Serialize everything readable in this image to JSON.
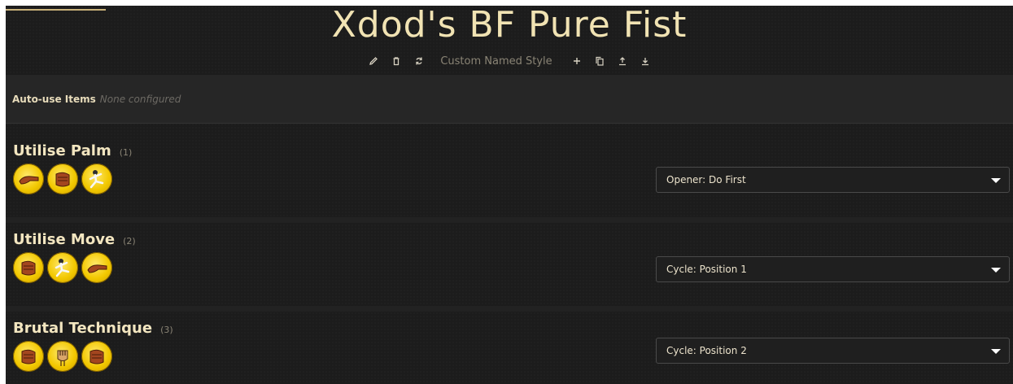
{
  "header": {
    "title": "Xdod's BF Pure Fist",
    "style_name": "Custom Named Style",
    "icons": [
      "pencil-icon",
      "trash-icon",
      "refresh-icon",
      "plus-icon",
      "copy-icon",
      "upload-icon",
      "download-icon"
    ]
  },
  "auto_use": {
    "label": "Auto-use Items",
    "value": "None configured"
  },
  "sections": [
    {
      "name": "Utilise Palm",
      "count": "(1)",
      "abilities": [
        "palm-strike-icon",
        "fist-strike-icon",
        "kick-pose-icon"
      ],
      "condition": "Opener: Do First"
    },
    {
      "name": "Utilise Move",
      "count": "(2)",
      "abilities": [
        "fist-strike-icon",
        "kick-pose-icon",
        "palm-strike-icon"
      ],
      "condition": "Cycle: Position 1"
    },
    {
      "name": "Brutal Technique",
      "count": "(3)",
      "abilities": [
        "fist-strike-icon",
        "clenched-fist-icon",
        "fist-strike-icon"
      ],
      "condition": "Cycle: Position 2"
    }
  ],
  "colors": {
    "background": "#1c1c1c",
    "title": "#f1e3b3",
    "ability_gold": "#f2c800",
    "muted": "#8a8475"
  }
}
